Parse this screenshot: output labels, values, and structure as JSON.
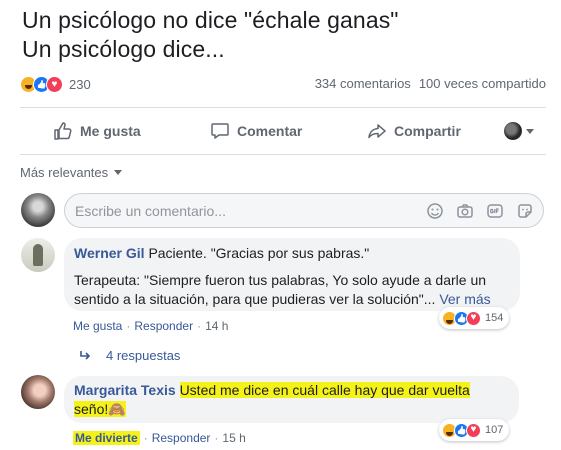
{
  "post": {
    "title_line1": "Un psicólogo no dice \"échale ganas\"",
    "title_line2": "Un psicólogo dice..."
  },
  "stats": {
    "reaction_icons": [
      "haha-icon",
      "like-icon",
      "love-icon"
    ],
    "reaction_count": "230",
    "comments": "334 comentarios",
    "shares": "100 veces compartido"
  },
  "actions": {
    "like": "Me gusta",
    "comment": "Comentar",
    "share": "Compartir"
  },
  "sort": {
    "label": "Más relevantes"
  },
  "composer": {
    "placeholder": "Escribe un comentario..."
  },
  "comments": [
    {
      "author": "Werner Gil",
      "text_line1": "Paciente. \"Gracias por sus pabras.\"",
      "text_para": "Terapeuta: \"Siempre fueron tus palabras, Yo solo ayude a darle un sentido a la situación, para que pudieras ver la solución\"...",
      "see_more": "Ver más",
      "like_link": "Me gusta",
      "reply_link": "Responder",
      "time": "14 h",
      "reaction_count": "154",
      "replies": "4 respuestas"
    },
    {
      "author": "Margarita Texis",
      "text_hl1": "Usted me dice en cuál calle hay que dar vuelta",
      "text_hl2": "seño!",
      "emoji": "🙈",
      "reaction_link": "Me divierte",
      "reply_link": "Responder",
      "time": "15 h",
      "reaction_count": "107"
    }
  ],
  "colors": {
    "link": "#385898",
    "highlight": "#f5f21a",
    "like_blue": "#1877f2",
    "haha_yellow": "#f7b125",
    "love_red": "#f33e58"
  }
}
